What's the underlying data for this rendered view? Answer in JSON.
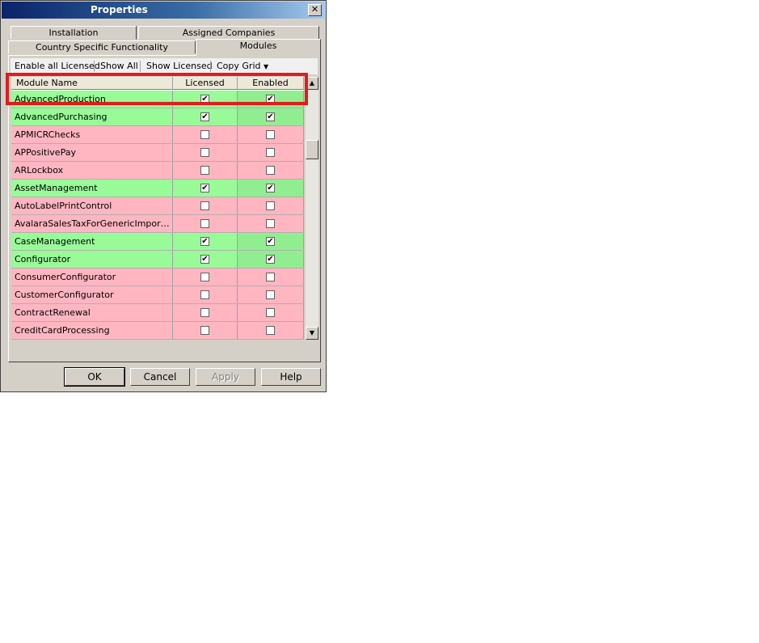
{
  "window": {
    "title": "Properties",
    "close_glyph": "✕"
  },
  "tabs": {
    "row1": [
      "Installation",
      "Assigned Companies"
    ],
    "row2": [
      "Country Specific Functionality",
      "Modules"
    ]
  },
  "toolbar": {
    "enable_all_licensed": "Enable all Licensed",
    "show_all": "Show All",
    "show_licensed": "Show Licensed",
    "copy_grid": "Copy Grid"
  },
  "grid": {
    "columns": [
      "Module Name",
      "Licensed",
      "Enabled"
    ],
    "rows": [
      {
        "name": "AdvancedProduction",
        "licensed": true,
        "enabled": true
      },
      {
        "name": "AdvancedPurchasing",
        "licensed": true,
        "enabled": true
      },
      {
        "name": "APMICRChecks",
        "licensed": false,
        "enabled": false
      },
      {
        "name": "APPositivePay",
        "licensed": false,
        "enabled": false
      },
      {
        "name": "ARLockbox",
        "licensed": false,
        "enabled": false
      },
      {
        "name": "AssetManagement",
        "licensed": true,
        "enabled": true
      },
      {
        "name": "AutoLabelPrintControl",
        "licensed": false,
        "enabled": false
      },
      {
        "name": "AvalaraSalesTaxForGenericImportProc...",
        "licensed": false,
        "enabled": false
      },
      {
        "name": "CaseManagement",
        "licensed": true,
        "enabled": true
      },
      {
        "name": "Configurator",
        "licensed": true,
        "enabled": true
      },
      {
        "name": "ConsumerConfigurator",
        "licensed": false,
        "enabled": false
      },
      {
        "name": "CustomerConfigurator",
        "licensed": false,
        "enabled": false
      },
      {
        "name": "ContractRenewal",
        "licensed": false,
        "enabled": false
      },
      {
        "name": "CreditCardProcessing",
        "licensed": false,
        "enabled": false
      }
    ]
  },
  "buttons": {
    "ok": "OK",
    "cancel": "Cancel",
    "apply": "Apply",
    "help": "Help"
  },
  "colors": {
    "licensed_row": "#98fb98",
    "unlicensed_row": "#ffb6c1",
    "highlight": "#e01c1c"
  }
}
